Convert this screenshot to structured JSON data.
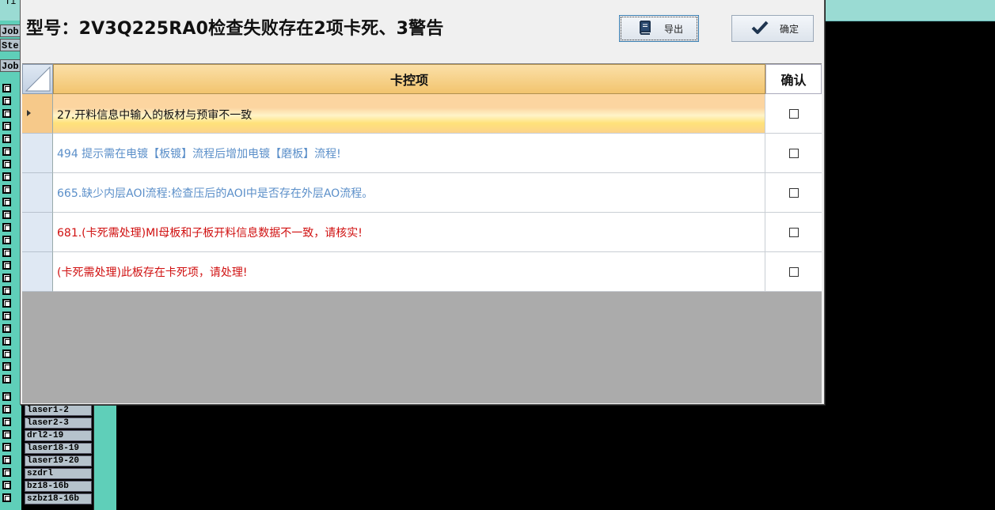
{
  "background": {
    "top_fragment": "Ti",
    "tabs": [
      "Job",
      "Ste",
      "Job"
    ],
    "layer_list": [
      "laser1-2",
      "laser2-3",
      "drl2-19",
      "laser18-19",
      "laser19-20",
      "szdrl",
      "bz18-16b",
      "szbz18-16b"
    ],
    "colors": {
      "teal": "#5fcfb9",
      "light_teal": "#9adbd3"
    }
  },
  "dialog": {
    "title": "型号：2V3Q225RA0检查失败存在2项卡死、3警告",
    "buttons": {
      "export": {
        "label": "导出",
        "icon": "book-icon"
      },
      "ok": {
        "label": "确定",
        "icon": "checkmark-icon"
      }
    },
    "grid": {
      "columns": {
        "main": "卡控项",
        "confirm": "确认"
      },
      "rows": [
        {
          "text": "27.开料信息中输入的板材与预审不一致",
          "color": "#111111",
          "selected": true,
          "checked": false
        },
        {
          "text": "494 提示需在电镀【板镀】流程后增加电镀【磨板】流程!",
          "color": "#5b8fc9",
          "selected": false,
          "checked": false
        },
        {
          "text": "665.缺少内层AOI流程:检查压后的AOI中是否存在外层AO流程。",
          "color": "#5b8fc9",
          "selected": false,
          "checked": false
        },
        {
          "text": "681.(卡死需处理)MI母板和子板开料信息数据不一致，请核实!",
          "color": "#d01010",
          "selected": false,
          "checked": false
        },
        {
          "text": "(卡死需处理)此板存在卡死项，请处理!",
          "color": "#d01010",
          "selected": false,
          "checked": false
        }
      ]
    }
  }
}
